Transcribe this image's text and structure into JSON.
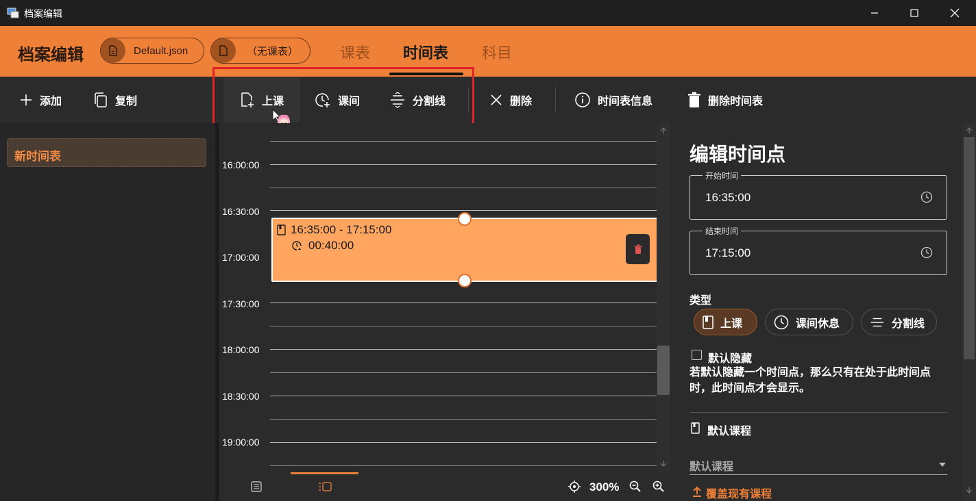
{
  "window": {
    "title": "档案编辑"
  },
  "header": {
    "title": "档案编辑",
    "profile_file": "Default.json",
    "class_table": "（无课表）",
    "tabs": [
      {
        "label": "课表",
        "active": false
      },
      {
        "label": "时间表",
        "active": true
      },
      {
        "label": "科目",
        "active": false
      }
    ]
  },
  "toolbar": {
    "add": "添加",
    "copy": "复制",
    "class": "上课",
    "break": "课间",
    "divider": "分割线",
    "delete": "删除",
    "info": "时间表信息",
    "delete_table": "删除时间表"
  },
  "sidebar": {
    "items": [
      {
        "label": "新时间表",
        "selected": true
      }
    ]
  },
  "timeline": {
    "labels": [
      "16:00:00",
      "16:30:00",
      "17:00:00",
      "17:30:00",
      "18:00:00",
      "18:30:00",
      "19:00:00"
    ],
    "block": {
      "range": "16:35:00 - 17:15:00",
      "duration": "00:40:00"
    },
    "zoom": "300%"
  },
  "editor": {
    "title": "编辑时间点",
    "start_label": "开始时间",
    "start_value": "16:35:00",
    "end_label": "结束时间",
    "end_value": "17:15:00",
    "type_label": "类型",
    "types": [
      "上课",
      "课间休息",
      "分割线"
    ],
    "selected_type": "上课",
    "hide_label": "默认隐藏",
    "hide_checked": false,
    "hide_desc": "若默认隐藏一个时间点，那么只有在处于此时间点时，此时间点才会显示。",
    "default_course_title": "默认课程",
    "default_course_placeholder": "默认课程",
    "override": "覆盖现有课程"
  },
  "colors": {
    "accent": "#ef8038",
    "block": "#ffa560",
    "highlight": "#e0242a"
  }
}
